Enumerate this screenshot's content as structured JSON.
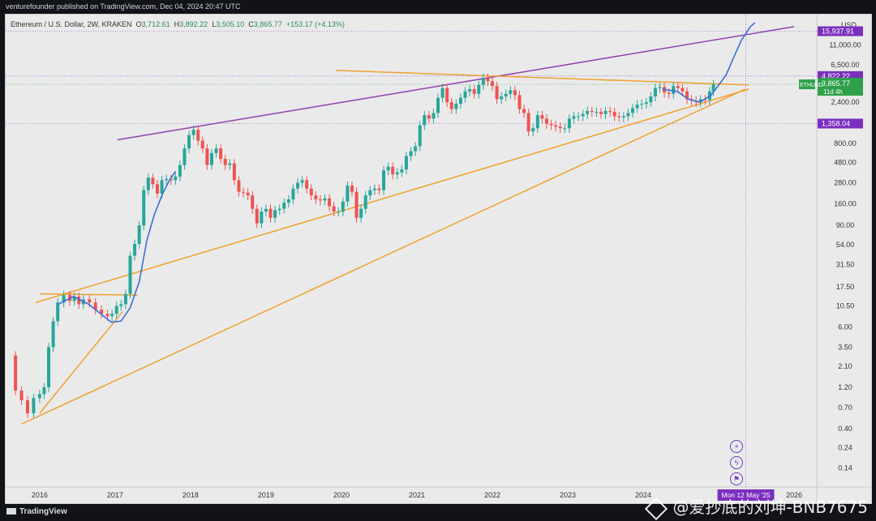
{
  "header": {
    "publisher": "venturefounder published on TradingView.com, Dec 04, 2024 20:47 UTC",
    "legend": {
      "symbol": "Ethereum / U.S. Dollar, 2W, KRAKEN",
      "open_label": "O",
      "open": "3,712.61",
      "high_label": "H",
      "high": "3,892.22",
      "low_label": "L",
      "low": "3,505.10",
      "close_label": "C",
      "close": "3,865.77",
      "change": "+153.17 (+4.13%)"
    }
  },
  "footer": {
    "brand": "TradingView",
    "watermark": "@爱抄底的刘坤-BNB7675"
  },
  "chart_data": {
    "type": "candlestick",
    "scale": "log",
    "currency": "USD",
    "y_ticks": [
      "0.14",
      "0.24",
      "0.40",
      "0.70",
      "1.20",
      "2.10",
      "3.50",
      "6.00",
      "10.50",
      "17.50",
      "31.50",
      "54.00",
      "90.00",
      "160.00",
      "280.00",
      "480.00",
      "800.00",
      "2,400.00",
      "6,500.00",
      "11,000.00"
    ],
    "y_tick_values": [
      0.14,
      0.24,
      0.4,
      0.7,
      1.2,
      2.1,
      3.5,
      6.0,
      10.5,
      17.5,
      31.5,
      54.0,
      90.0,
      160.0,
      280.0,
      480.0,
      800.0,
      2400.0,
      6500.0,
      11000.0
    ],
    "ylim": [
      0.1,
      20000
    ],
    "x_ticks": [
      "2016",
      "2017",
      "2018",
      "2019",
      "2020",
      "2021",
      "2022",
      "2023",
      "2024",
      "2026"
    ],
    "x_tick_values": [
      2016.0,
      2017.0,
      2018.0,
      2019.0,
      2020.0,
      2021.0,
      2022.0,
      2023.0,
      2024.0,
      2026.0
    ],
    "xlim": [
      2015.55,
      2026.3
    ],
    "price_labels": [
      {
        "text": "15,937.91",
        "value": 15937.91,
        "color": "#7b2fbf",
        "style": "purple"
      },
      {
        "text": "4,822.22",
        "value": 4822.22,
        "color": "#7b2fbf",
        "style": "purple"
      },
      {
        "text": "3,865.77",
        "value": 3865.77,
        "color": "#2ea04a",
        "style": "green",
        "sub": "11d 4h",
        "tag": "ETHUSD"
      },
      {
        "text": "1,358.04",
        "value": 1358.04,
        "color": "#7b2fbf",
        "style": "purple"
      }
    ],
    "time_label": {
      "text": "Mon 12 May '25",
      "x": 2025.36,
      "color": "#7b2fbf"
    },
    "price_series": [
      [
        2015.6,
        2.8
      ],
      [
        2015.68,
        1.1
      ],
      [
        2015.76,
        0.85
      ],
      [
        2015.84,
        0.6
      ],
      [
        2015.92,
        0.9
      ],
      [
        2016.0,
        1.0
      ],
      [
        2016.06,
        1.2
      ],
      [
        2016.12,
        3.5
      ],
      [
        2016.18,
        7.0
      ],
      [
        2016.24,
        11.5
      ],
      [
        2016.32,
        14.0
      ],
      [
        2016.4,
        12.0
      ],
      [
        2016.46,
        13.5
      ],
      [
        2016.52,
        11.0
      ],
      [
        2016.58,
        12.5
      ],
      [
        2016.66,
        11.5
      ],
      [
        2016.74,
        9.5
      ],
      [
        2016.82,
        8.5
      ],
      [
        2016.9,
        8.0
      ],
      [
        2016.96,
        8.5
      ],
      [
        2017.02,
        10.5
      ],
      [
        2017.08,
        11.0
      ],
      [
        2017.14,
        14.5
      ],
      [
        2017.2,
        40.0
      ],
      [
        2017.26,
        55.0
      ],
      [
        2017.32,
        90.0
      ],
      [
        2017.38,
        230.0
      ],
      [
        2017.44,
        320.0
      ],
      [
        2017.5,
        270.0
      ],
      [
        2017.56,
        210.0
      ],
      [
        2017.62,
        300.0
      ],
      [
        2017.68,
        310.0
      ],
      [
        2017.74,
        300.0
      ],
      [
        2017.8,
        330.0
      ],
      [
        2017.86,
        450.0
      ],
      [
        2017.92,
        700.0
      ],
      [
        2017.98,
        1000.0
      ],
      [
        2018.04,
        1150.0
      ],
      [
        2018.1,
        860.0
      ],
      [
        2018.16,
        700.0
      ],
      [
        2018.22,
        450.0
      ],
      [
        2018.28,
        620.0
      ],
      [
        2018.34,
        700.0
      ],
      [
        2018.4,
        530.0
      ],
      [
        2018.46,
        450.0
      ],
      [
        2018.52,
        470.0
      ],
      [
        2018.58,
        300.0
      ],
      [
        2018.64,
        220.0
      ],
      [
        2018.7,
        215.0
      ],
      [
        2018.76,
        200.0
      ],
      [
        2018.82,
        140.0
      ],
      [
        2018.88,
        95.0
      ],
      [
        2018.94,
        130.0
      ],
      [
        2019.0,
        140.0
      ],
      [
        2019.06,
        110.0
      ],
      [
        2019.12,
        135.0
      ],
      [
        2019.18,
        140.0
      ],
      [
        2019.24,
        165.0
      ],
      [
        2019.3,
        180.0
      ],
      [
        2019.36,
        240.0
      ],
      [
        2019.42,
        280.0
      ],
      [
        2019.48,
        300.0
      ],
      [
        2019.54,
        240.0
      ],
      [
        2019.6,
        200.0
      ],
      [
        2019.66,
        180.0
      ],
      [
        2019.72,
        175.0
      ],
      [
        2019.78,
        185.0
      ],
      [
        2019.84,
        150.0
      ],
      [
        2019.9,
        130.0
      ],
      [
        2019.96,
        130.0
      ],
      [
        2020.02,
        170.0
      ],
      [
        2020.08,
        260.0
      ],
      [
        2020.14,
        220.0
      ],
      [
        2020.2,
        110.0
      ],
      [
        2020.26,
        140.0
      ],
      [
        2020.32,
        200.0
      ],
      [
        2020.38,
        230.0
      ],
      [
        2020.44,
        240.0
      ],
      [
        2020.5,
        230.0
      ],
      [
        2020.56,
        390.0
      ],
      [
        2020.62,
        430.0
      ],
      [
        2020.68,
        350.0
      ],
      [
        2020.74,
        370.0
      ],
      [
        2020.8,
        400.0
      ],
      [
        2020.86,
        570.0
      ],
      [
        2020.92,
        650.0
      ],
      [
        2020.98,
        740.0
      ],
      [
        2021.04,
        1300.0
      ],
      [
        2021.1,
        1700.0
      ],
      [
        2021.16,
        1550.0
      ],
      [
        2021.22,
        1800.0
      ],
      [
        2021.28,
        2700.0
      ],
      [
        2021.34,
        3500.0
      ],
      [
        2021.4,
        2400.0
      ],
      [
        2021.46,
        2000.0
      ],
      [
        2021.52,
        2300.0
      ],
      [
        2021.58,
        2700.0
      ],
      [
        2021.64,
        3200.0
      ],
      [
        2021.7,
        3400.0
      ],
      [
        2021.76,
        3000.0
      ],
      [
        2021.82,
        3800.0
      ],
      [
        2021.88,
        4600.0
      ],
      [
        2021.94,
        4200.0
      ],
      [
        2022.0,
        3700.0
      ],
      [
        2022.06,
        2600.0
      ],
      [
        2022.12,
        2800.0
      ],
      [
        2022.18,
        3000.0
      ],
      [
        2022.24,
        3300.0
      ],
      [
        2022.3,
        2900.0
      ],
      [
        2022.36,
        2000.0
      ],
      [
        2022.42,
        1800.0
      ],
      [
        2022.48,
        1100.0
      ],
      [
        2022.54,
        1200.0
      ],
      [
        2022.6,
        1700.0
      ],
      [
        2022.66,
        1550.0
      ],
      [
        2022.72,
        1350.0
      ],
      [
        2022.78,
        1300.0
      ],
      [
        2022.84,
        1250.0
      ],
      [
        2022.9,
        1200.0
      ],
      [
        2022.96,
        1200.0
      ],
      [
        2023.02,
        1550.0
      ],
      [
        2023.08,
        1650.0
      ],
      [
        2023.14,
        1650.0
      ],
      [
        2023.2,
        1750.0
      ],
      [
        2023.26,
        1900.0
      ],
      [
        2023.32,
        1850.0
      ],
      [
        2023.38,
        1850.0
      ],
      [
        2023.44,
        1750.0
      ],
      [
        2023.5,
        1900.0
      ],
      [
        2023.56,
        1850.0
      ],
      [
        2023.62,
        1650.0
      ],
      [
        2023.68,
        1600.0
      ],
      [
        2023.74,
        1650.0
      ],
      [
        2023.8,
        1800.0
      ],
      [
        2023.86,
        2050.0
      ],
      [
        2023.92,
        2250.0
      ],
      [
        2023.98,
        2300.0
      ],
      [
        2024.04,
        2400.0
      ],
      [
        2024.1,
        2800.0
      ],
      [
        2024.16,
        3500.0
      ],
      [
        2024.22,
        3600.0
      ],
      [
        2024.28,
        3100.0
      ],
      [
        2024.34,
        3000.0
      ],
      [
        2024.4,
        3700.0
      ],
      [
        2024.46,
        3500.0
      ],
      [
        2024.52,
        3200.0
      ],
      [
        2024.58,
        2600.0
      ],
      [
        2024.64,
        2500.0
      ],
      [
        2024.7,
        2400.0
      ],
      [
        2024.76,
        2600.0
      ],
      [
        2024.82,
        2550.0
      ],
      [
        2024.88,
        3200.0
      ],
      [
        2024.93,
        3865.77
      ]
    ],
    "trendlines": [
      {
        "name": "",
        "color": "#8e44ad",
        "points": [
          [
            2017.03,
            880
          ],
          [
            2026.0,
            18000
          ]
        ]
      },
      {
        "name": "",
        "color": "#f0a030",
        "points": [
          [
            2019.93,
            5600
          ],
          [
            2025.4,
            3800
          ]
        ]
      },
      {
        "name": "",
        "color": "#f0a030",
        "points": [
          [
            2015.76,
            0.45
          ],
          [
            2025.35,
            3400
          ]
        ]
      },
      {
        "name": "",
        "color": "#f0a030",
        "points": [
          [
            2015.95,
            11.5
          ],
          [
            2025.4,
            3400
          ]
        ]
      },
      {
        "name": "",
        "color": "#f0a030",
        "points": [
          [
            2016.0,
            14.5
          ],
          [
            2017.3,
            14.0
          ]
        ]
      },
      {
        "name": "",
        "color": "#f0a030",
        "points": [
          [
            2016.0,
            0.6
          ],
          [
            2017.1,
            9.0
          ]
        ]
      }
    ],
    "fit_curves": [
      {
        "name": "",
        "color": "#3a6fd8",
        "points": [
          [
            2016.25,
            11.0
          ],
          [
            2016.45,
            13.5
          ],
          [
            2016.65,
            11.0
          ],
          [
            2016.85,
            8.0
          ],
          [
            2016.95,
            6.8
          ],
          [
            2017.08,
            7.0
          ],
          [
            2017.2,
            10.0
          ],
          [
            2017.32,
            20.0
          ],
          [
            2017.42,
            60.0
          ],
          [
            2017.52,
            120.0
          ],
          [
            2017.62,
            200.0
          ],
          [
            2017.72,
            300.0
          ],
          [
            2017.8,
            380.0
          ]
        ]
      },
      {
        "name": "",
        "color": "#3a6fd8",
        "points": [
          [
            2024.25,
            3400
          ],
          [
            2024.45,
            3200
          ],
          [
            2024.6,
            2600
          ],
          [
            2024.75,
            2400
          ],
          [
            2024.9,
            2900
          ],
          [
            2025.0,
            3800
          ],
          [
            2025.1,
            5000
          ],
          [
            2025.2,
            8000
          ],
          [
            2025.3,
            12500
          ],
          [
            2025.42,
            18000
          ],
          [
            2025.48,
            20000
          ]
        ]
      }
    ],
    "horizontal_dotted": [
      15937.91,
      4822.22,
      3865.77,
      1358.04
    ]
  }
}
